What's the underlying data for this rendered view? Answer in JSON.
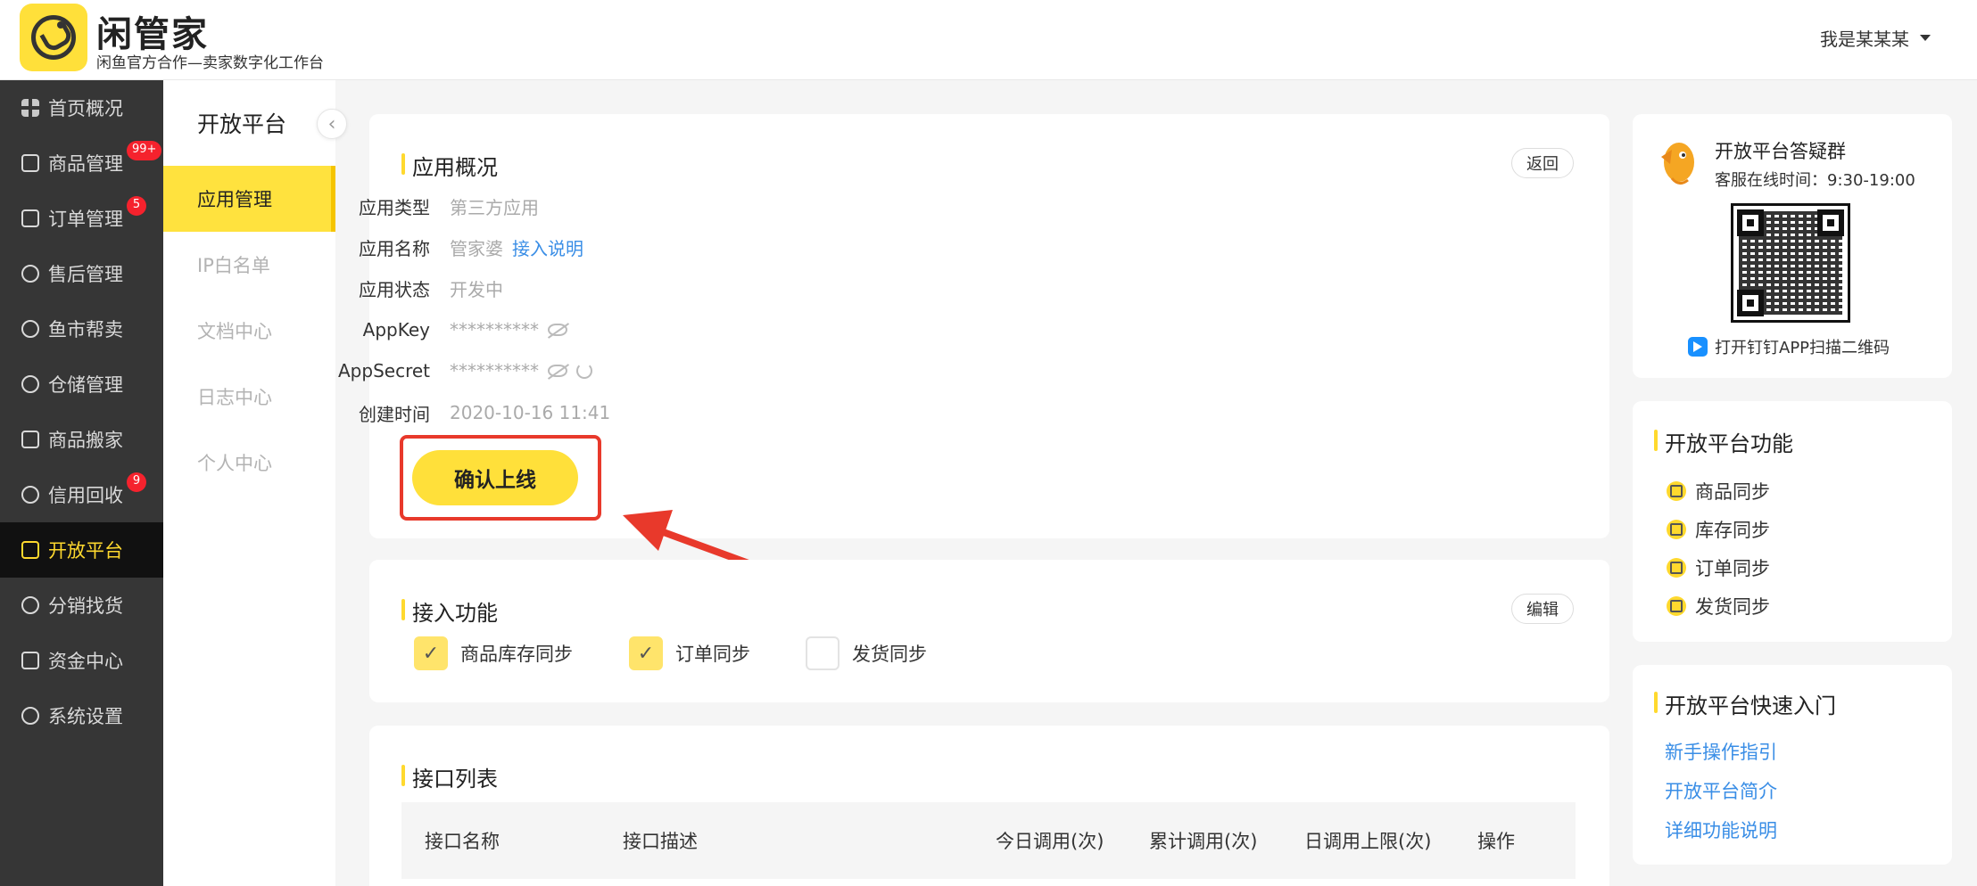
{
  "header": {
    "brand_name": "闲管家",
    "brand_sub": "闲鱼官方合作—卖家数字化工作台",
    "user_name": "我是某某某"
  },
  "sidebar": {
    "items": [
      {
        "label": "首页概况",
        "icon": "grid-icon"
      },
      {
        "label": "商品管理",
        "icon": "goods-icon",
        "badge": "99+"
      },
      {
        "label": "订单管理",
        "icon": "order-icon",
        "badge": "5"
      },
      {
        "label": "售后管理",
        "icon": "service-icon"
      },
      {
        "label": "鱼市帮卖",
        "icon": "fish-market-icon"
      },
      {
        "label": "仓储管理",
        "icon": "warehouse-icon"
      },
      {
        "label": "商品搬家",
        "icon": "move-icon"
      },
      {
        "label": "信用回收",
        "icon": "recycle-icon",
        "badge": "9"
      },
      {
        "label": "开放平台",
        "icon": "open-platform-icon",
        "active": true
      },
      {
        "label": "分销找货",
        "icon": "distribution-icon"
      },
      {
        "label": "资金中心",
        "icon": "fund-icon"
      },
      {
        "label": "系统设置",
        "icon": "settings-icon"
      }
    ]
  },
  "subnav": {
    "title": "开放平台",
    "items": [
      "应用管理",
      "IP白名单",
      "文档中心",
      "日志中心",
      "个人中心"
    ]
  },
  "overview": {
    "title": "应用概况",
    "back_label": "返回",
    "type_label": "应用类型",
    "type_value": "第三方应用",
    "name_label": "应用名称",
    "name_value": "管家婆",
    "name_link": "接入说明",
    "status_label": "应用状态",
    "status_value": "开发中",
    "appkey_label": "AppKey",
    "appkey_value": "**********",
    "appsecret_label": "AppSecret",
    "appsecret_value": "**********",
    "created_label": "创建时间",
    "created_value": "2020-10-16 11:41",
    "confirm_label": "确认上线"
  },
  "access": {
    "title": "接入功能",
    "edit_label": "编辑",
    "options": [
      {
        "label": "商品库存同步",
        "checked": true
      },
      {
        "label": "订单同步",
        "checked": true
      },
      {
        "label": "发货同步",
        "checked": false
      }
    ]
  },
  "api_list": {
    "title": "接口列表",
    "columns": [
      "接口名称",
      "接口描述",
      "今日调用(次)",
      "累计调用(次)",
      "日调用上限(次)",
      "操作"
    ]
  },
  "support": {
    "title": "开放平台答疑群",
    "hours": "客服在线时间：9:30-19:00",
    "scan_hint": "打开钉钉APP扫描二维码"
  },
  "features": {
    "title": "开放平台功能",
    "items": [
      "商品同步",
      "库存同步",
      "订单同步",
      "发货同步"
    ]
  },
  "quickstart": {
    "title": "开放平台快速入门",
    "links": [
      "新手操作指引",
      "开放平台简介",
      "详细功能说明"
    ]
  },
  "colors": {
    "brand_yellow": "#ffe03a",
    "sidebar_bg": "#363636",
    "link_blue": "#3a8ee6",
    "highlight_red": "#e8392b"
  }
}
